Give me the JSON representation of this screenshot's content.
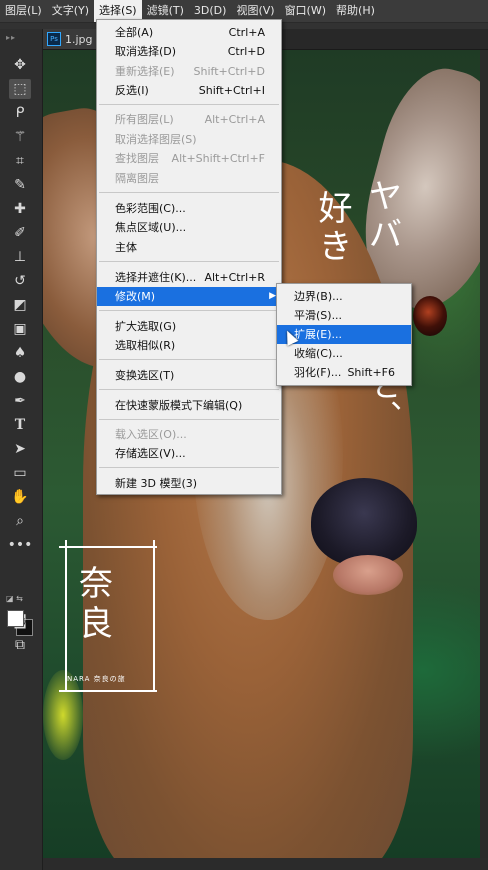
{
  "menubar": {
    "items": [
      "图层(L)",
      "文字(Y)",
      "选择(S)",
      "滤镜(T)",
      "3D(D)",
      "视图(V)",
      "窗口(W)",
      "帮助(H)"
    ]
  },
  "document": {
    "tab_label": "1.jpg @"
  },
  "toolbar": {
    "tools": [
      "move-icon",
      "marquee-icon",
      "lasso-icon",
      "magic-wand-icon",
      "crop-icon",
      "eyedropper-icon",
      "healing-brush-icon",
      "brush-icon",
      "stamp-icon",
      "history-brush-icon",
      "eraser-icon",
      "gradient-icon",
      "blur-icon",
      "dodge-icon",
      "pen-icon",
      "type-icon",
      "path-select-icon",
      "rectangle-icon",
      "hand-icon",
      "zoom-icon",
      "more-icon"
    ],
    "type_tool_glyph": "T"
  },
  "select_menu": {
    "items": [
      {
        "label": "全部(A)",
        "shortcut": "Ctrl+A",
        "disabled": false
      },
      {
        "label": "取消选择(D)",
        "shortcut": "Ctrl+D",
        "disabled": false
      },
      {
        "label": "重新选择(E)",
        "shortcut": "Shift+Ctrl+D",
        "disabled": true
      },
      {
        "label": "反选(I)",
        "shortcut": "Shift+Ctrl+I",
        "disabled": false
      },
      {
        "label": "所有图层(L)",
        "shortcut": "Alt+Ctrl+A",
        "disabled": true
      },
      {
        "label": "取消选择图层(S)",
        "shortcut": "",
        "disabled": true
      },
      {
        "label": "查找图层",
        "shortcut": "Alt+Shift+Ctrl+F",
        "disabled": true
      },
      {
        "label": "隔离图层",
        "shortcut": "",
        "disabled": true
      },
      {
        "label": "色彩范围(C)...",
        "shortcut": "",
        "disabled": false
      },
      {
        "label": "焦点区域(U)...",
        "shortcut": "",
        "disabled": false
      },
      {
        "label": "主体",
        "shortcut": "",
        "disabled": false
      },
      {
        "label": "选择并遮住(K)...",
        "shortcut": "Alt+Ctrl+R",
        "disabled": false
      },
      {
        "label": "修改(M)",
        "shortcut": "",
        "disabled": false
      },
      {
        "label": "扩大选取(G)",
        "shortcut": "",
        "disabled": false
      },
      {
        "label": "选取相似(R)",
        "shortcut": "",
        "disabled": false
      },
      {
        "label": "变换选区(T)",
        "shortcut": "",
        "disabled": false
      },
      {
        "label": "在快速蒙版模式下编辑(Q)",
        "shortcut": "",
        "disabled": false
      },
      {
        "label": "载入选区(O)...",
        "shortcut": "",
        "disabled": true
      },
      {
        "label": "存储选区(V)...",
        "shortcut": "",
        "disabled": false
      },
      {
        "label": "新建 3D 模型(3)",
        "shortcut": "",
        "disabled": false
      }
    ]
  },
  "modify_submenu": {
    "items": [
      {
        "label": "边界(B)...",
        "shortcut": ""
      },
      {
        "label": "平滑(S)...",
        "shortcut": ""
      },
      {
        "label": "扩展(E)...",
        "shortcut": ""
      },
      {
        "label": "收缩(C)...",
        "shortcut": ""
      },
      {
        "label": "羽化(F)...",
        "shortcut": "Shift+F6"
      }
    ]
  },
  "poster": {
    "vertical_text_1": "ヤバ",
    "vertical_text_2": "好き",
    "vertical_text_3": "ど、",
    "title_char_1": "奈",
    "title_char_2": "良",
    "subtitle": "NARA 奈良の旅"
  },
  "colors": {
    "menu_highlight": "#1a70e0",
    "app_bg": "#232323"
  }
}
